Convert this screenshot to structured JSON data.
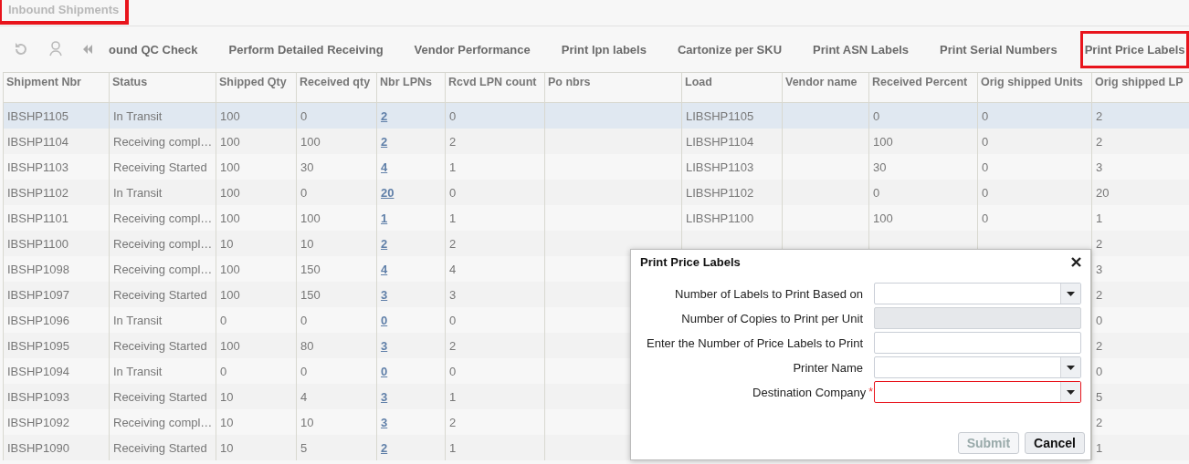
{
  "page": {
    "title": "Inbound Shipments",
    "highlighted": true
  },
  "toolbar": {
    "actions": [
      {
        "label": "ound QC Check",
        "highlighted": false
      },
      {
        "label": "Perform Detailed Receiving",
        "highlighted": false
      },
      {
        "label": "Vendor Performance",
        "highlighted": false
      },
      {
        "label": "Print lpn labels",
        "highlighted": false
      },
      {
        "label": "Cartonize per SKU",
        "highlighted": false
      },
      {
        "label": "Print ASN Labels",
        "highlighted": false
      },
      {
        "label": "Print Serial Numbers",
        "highlighted": false
      },
      {
        "label": "Print Price Labels",
        "highlighted": true
      }
    ]
  },
  "table": {
    "columns": [
      "Shipment Nbr",
      "Status",
      "Shipped Qty",
      "Received qty",
      "Nbr LPNs",
      "Rcvd LPN count",
      "Po nbrs",
      "Load",
      "Vendor name",
      "Received Percent",
      "Orig shipped Units",
      "Orig shipped LP"
    ],
    "rows": [
      {
        "shipment_nbr": "IBSHP1105",
        "status": "In Transit",
        "shipped_qty": "100",
        "received_qty": "0",
        "nbr_lpns": "2",
        "rcvd_lpn_count": "0",
        "load": "LIBSHP1105",
        "received_percent": "0",
        "orig_shipped_units": "0",
        "orig_shipped_lpns": "2",
        "selected": true
      },
      {
        "shipment_nbr": "IBSHP1104",
        "status": "Receiving compl…",
        "shipped_qty": "100",
        "received_qty": "100",
        "nbr_lpns": "2",
        "rcvd_lpn_count": "2",
        "load": "LIBSHP1104",
        "received_percent": "100",
        "orig_shipped_units": "0",
        "orig_shipped_lpns": "2",
        "selected": false
      },
      {
        "shipment_nbr": "IBSHP1103",
        "status": "Receiving Started",
        "shipped_qty": "100",
        "received_qty": "30",
        "nbr_lpns": "4",
        "rcvd_lpn_count": "1",
        "load": "LIBSHP1103",
        "received_percent": "30",
        "orig_shipped_units": "0",
        "orig_shipped_lpns": "3",
        "selected": false
      },
      {
        "shipment_nbr": "IBSHP1102",
        "status": "In Transit",
        "shipped_qty": "100",
        "received_qty": "0",
        "nbr_lpns": "20",
        "rcvd_lpn_count": "0",
        "load": "LIBSHP1102",
        "received_percent": "0",
        "orig_shipped_units": "0",
        "orig_shipped_lpns": "20",
        "selected": false
      },
      {
        "shipment_nbr": "IBSHP1101",
        "status": "Receiving compl…",
        "shipped_qty": "100",
        "received_qty": "100",
        "nbr_lpns": "1",
        "rcvd_lpn_count": "1",
        "load": "LIBSHP1100",
        "received_percent": "100",
        "orig_shipped_units": "0",
        "orig_shipped_lpns": "1",
        "selected": false
      },
      {
        "shipment_nbr": "IBSHP1100",
        "status": "Receiving compl…",
        "shipped_qty": "10",
        "received_qty": "10",
        "nbr_lpns": "2",
        "rcvd_lpn_count": "2",
        "orig_shipped_lpns": "2",
        "selected": false
      },
      {
        "shipment_nbr": "IBSHP1098",
        "status": "Receiving compl…",
        "shipped_qty": "100",
        "received_qty": "150",
        "nbr_lpns": "4",
        "rcvd_lpn_count": "4",
        "orig_shipped_lpns": "3",
        "selected": false
      },
      {
        "shipment_nbr": "IBSHP1097",
        "status": "Receiving Started",
        "shipped_qty": "100",
        "received_qty": "150",
        "nbr_lpns": "3",
        "rcvd_lpn_count": "3",
        "orig_shipped_lpns": "2",
        "selected": false
      },
      {
        "shipment_nbr": "IBSHP1096",
        "status": "In Transit",
        "shipped_qty": "0",
        "received_qty": "0",
        "nbr_lpns": "0",
        "rcvd_lpn_count": "0",
        "orig_shipped_lpns": "0",
        "selected": false
      },
      {
        "shipment_nbr": "IBSHP1095",
        "status": "Receiving Started",
        "shipped_qty": "100",
        "received_qty": "80",
        "nbr_lpns": "3",
        "rcvd_lpn_count": "2",
        "orig_shipped_lpns": "2",
        "selected": false
      },
      {
        "shipment_nbr": "IBSHP1094",
        "status": "In Transit",
        "shipped_qty": "0",
        "received_qty": "0",
        "nbr_lpns": "0",
        "rcvd_lpn_count": "0",
        "orig_shipped_lpns": "0",
        "selected": false
      },
      {
        "shipment_nbr": "IBSHP1093",
        "status": "Receiving Started",
        "shipped_qty": "10",
        "received_qty": "4",
        "nbr_lpns": "3",
        "rcvd_lpn_count": "1",
        "orig_shipped_lpns": "5",
        "selected": false
      },
      {
        "shipment_nbr": "IBSHP1092",
        "status": "Receiving compl…",
        "shipped_qty": "10",
        "received_qty": "10",
        "nbr_lpns": "3",
        "rcvd_lpn_count": "2",
        "orig_shipped_lpns": "2",
        "selected": false
      },
      {
        "shipment_nbr": "IBSHP1090",
        "status": "Receiving Started",
        "shipped_qty": "10",
        "received_qty": "5",
        "nbr_lpns": "2",
        "rcvd_lpn_count": "1",
        "orig_shipped_lpns": "1",
        "selected": false
      }
    ]
  },
  "dialog": {
    "title": "Print Price Labels",
    "fields": [
      {
        "label": "Number of Labels to Print Based on",
        "kind": "dropdown",
        "disabled": false,
        "required": false
      },
      {
        "label": "Number of Copies to Print per Unit",
        "kind": "text",
        "disabled": true,
        "required": false
      },
      {
        "label": "Enter the Number of Price Labels to Print",
        "kind": "text",
        "disabled": false,
        "required": false
      },
      {
        "label": "Printer Name",
        "kind": "dropdown",
        "disabled": false,
        "required": false
      },
      {
        "label": "Destination Company",
        "kind": "dropdown",
        "disabled": false,
        "required": true,
        "required_mark": "*"
      }
    ],
    "buttons": [
      {
        "label": "Submit",
        "disabled": true
      },
      {
        "label": "Cancel",
        "disabled": false
      }
    ]
  }
}
